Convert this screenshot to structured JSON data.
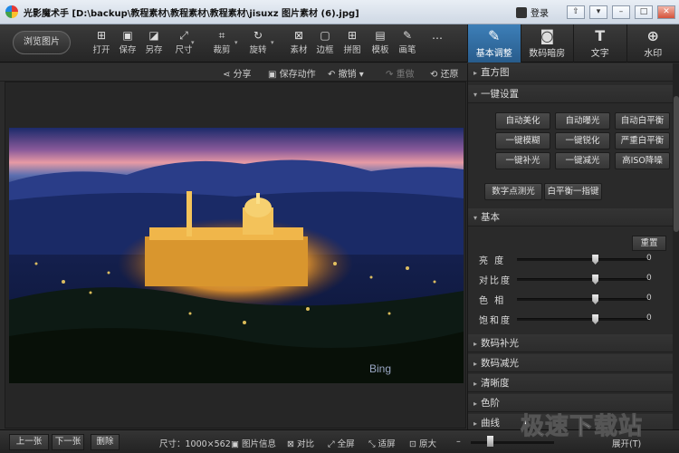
{
  "window": {
    "title": "光影魔术手 [D:\\backup\\教程素材\\教程素材\\教程素材\\jisuxz 图片素材 (6).jpg]",
    "login_label": "登录",
    "buttons": [
      "⇧",
      "▾",
      "–",
      "□",
      "✕"
    ]
  },
  "toolbar": {
    "browse_label": "浏览图片",
    "tools": [
      {
        "label": "打开",
        "icon": "open-icon",
        "glyph": "⊞"
      },
      {
        "label": "保存",
        "icon": "save-icon",
        "glyph": "▣"
      },
      {
        "label": "另存",
        "icon": "save-as-icon",
        "glyph": "◪"
      },
      {
        "label": "尺寸",
        "icon": "resize-icon",
        "glyph": "⤢"
      },
      {
        "label": "裁剪",
        "icon": "crop-icon",
        "glyph": "⌗"
      },
      {
        "label": "旋转",
        "icon": "rotate-icon",
        "glyph": "↻"
      },
      {
        "label": "素材",
        "icon": "material-icon",
        "glyph": "⊠"
      },
      {
        "label": "边框",
        "icon": "border-icon",
        "glyph": "▢"
      },
      {
        "label": "拼图",
        "icon": "collage-icon",
        "glyph": "⊞"
      },
      {
        "label": "模板",
        "icon": "template-icon",
        "glyph": "▤"
      },
      {
        "label": "画笔",
        "icon": "brush-icon",
        "glyph": "✎"
      },
      {
        "label": "",
        "icon": "more-icon",
        "glyph": "…"
      }
    ],
    "right_tabs": [
      {
        "label": "基本调整",
        "icon": "adjust-icon",
        "glyph": "✎",
        "active": true
      },
      {
        "label": "数码暗房",
        "icon": "darkroom-icon",
        "glyph": "◙",
        "active": false
      },
      {
        "label": "文字",
        "icon": "text-icon",
        "glyph": "T",
        "active": false
      },
      {
        "label": "水印",
        "icon": "watermark-icon",
        "glyph": "⊕",
        "active": false
      }
    ]
  },
  "actions": {
    "share": "分享",
    "save_action": "保存动作",
    "undo": "撤销",
    "redo": "重做",
    "restore": "还原"
  },
  "photo": {
    "caption": "Bing"
  },
  "panel": {
    "histogram": "直方图",
    "one_click": "一键设置",
    "one_click_buttons": [
      "自动美化",
      "自动曝光",
      "自动白平衡",
      "一键模糊",
      "一键锐化",
      "严重白平衡",
      "一键补光",
      "一键减光",
      "高ISO降噪"
    ],
    "extra_buttons": [
      "数字点测光",
      "白平衡一指键"
    ],
    "basic": "基本",
    "reset": "重置",
    "sliders": [
      {
        "label": "亮 度",
        "value": "0",
        "level": 0.59
      },
      {
        "label": "对比度",
        "value": "0",
        "level": 0.59
      },
      {
        "label": "色 相",
        "value": "0",
        "level": 0.59
      },
      {
        "label": "饱和度",
        "value": "0",
        "level": 0.59
      }
    ],
    "sections": [
      "数码补光",
      "数码减光",
      "清晰度",
      "色阶",
      "曲线"
    ]
  },
  "status": {
    "prev": "上一张",
    "next": "下一张",
    "delete": "删除",
    "size_label": "尺寸：1000×562",
    "image_info": "图片信息",
    "compare": "对比",
    "fullscreen": "全屏",
    "fit": "适屏",
    "original": "原大",
    "expand": "展开(T)"
  },
  "site_watermark": "极速下载站",
  "colors": {
    "accent": "#3272a8",
    "dark_bg": "#2b2b2b"
  }
}
